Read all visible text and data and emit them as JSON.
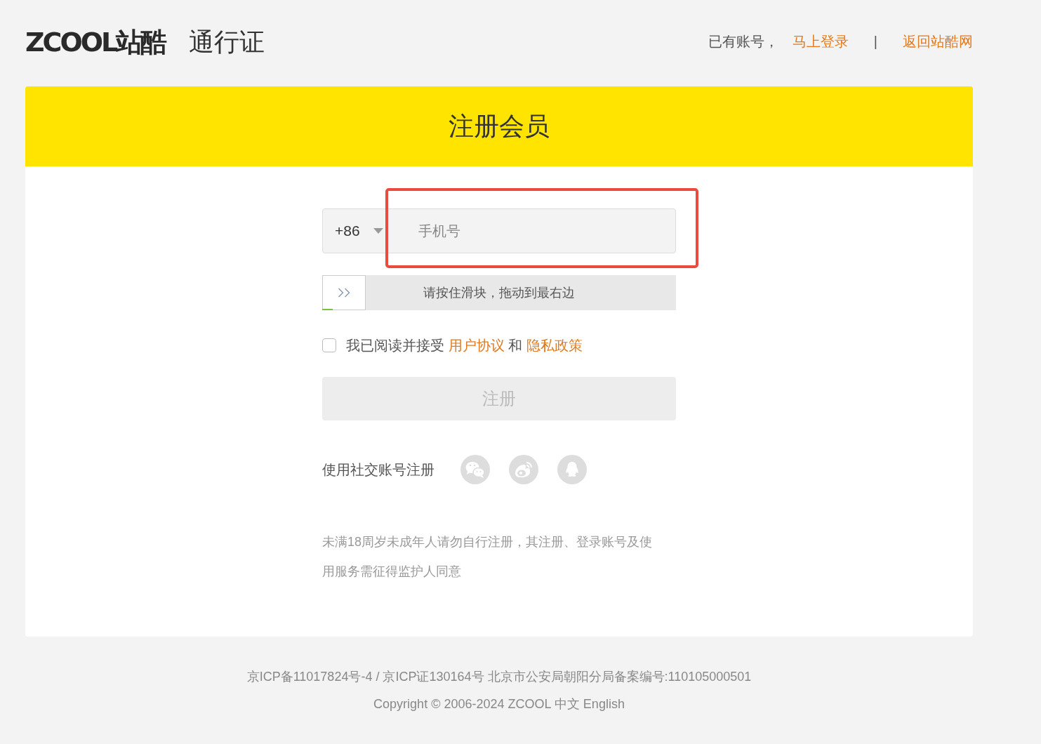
{
  "header": {
    "logo": "ZCOOL站酷",
    "subtitle": "通行证",
    "nav": [
      {
        "kind": "text",
        "text": "已有账号，"
      },
      {
        "kind": "link",
        "text": "马上登录"
      },
      {
        "kind": "separator",
        "text": "|"
      },
      {
        "kind": "link",
        "text": "返回站酷网"
      }
    ]
  },
  "card": {
    "title": "注册会员"
  },
  "phone": {
    "country_code": "+86",
    "placeholder": "手机号",
    "highlighted": true
  },
  "slider": {
    "label": "请按住滑块，拖动到最右边",
    "level": 0.03
  },
  "agreement": {
    "checked": false,
    "parts": [
      {
        "kind": "text",
        "text": "我已阅读并接受"
      },
      {
        "kind": "link",
        "text": "用户协议"
      },
      {
        "kind": "text",
        "text": "和"
      },
      {
        "kind": "link",
        "text": "隐私政策"
      }
    ]
  },
  "register_button": {
    "label": "注册",
    "disabled": true
  },
  "social": {
    "label": "使用社交账号注册",
    "buttons": [
      {
        "kind": "chat"
      },
      {
        "kind": "swirl"
      },
      {
        "kind": "penguin"
      }
    ]
  },
  "notice": "未满18周岁未成年人请勿自行注册，其注册、登录账号及使用服务需征得监护人同意",
  "footer": {
    "icp": [
      "京ICP备11017824号-4",
      "京ICP证130164号"
    ],
    "icp_separator": "/",
    "police_record": "北京市公安局朝阳分局备案编号:110105000501",
    "copyright": "Copyright © 2006-2024 ZCOOL",
    "languages": [
      "中文",
      "English"
    ]
  }
}
